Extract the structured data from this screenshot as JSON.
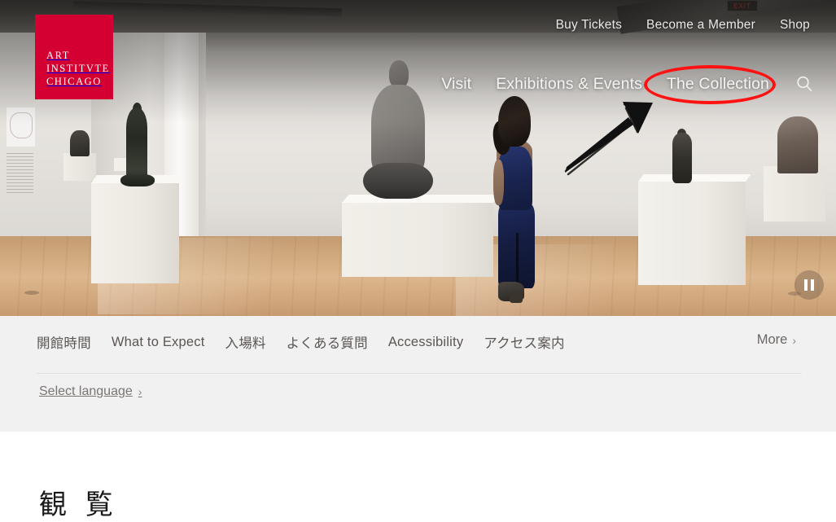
{
  "site": {
    "logo": {
      "lines": [
        "ART",
        "INSTITVTE",
        "CHICAGO"
      ],
      "color": "#d50032"
    }
  },
  "utility_nav": {
    "items": [
      {
        "label": "Buy Tickets"
      },
      {
        "label": "Become a Member"
      },
      {
        "label": "Shop"
      }
    ]
  },
  "main_nav": {
    "items": [
      {
        "label": "Visit"
      },
      {
        "label": "Exhibitions & Events"
      },
      {
        "label": "The Collection",
        "highlighted": true
      }
    ],
    "search_icon": "search-icon"
  },
  "hero": {
    "exit_sign": "EXIT",
    "media_control": {
      "icon": "pause-icon",
      "state": "playing"
    }
  },
  "annotations": {
    "ellipse": {
      "target": "The Collection",
      "color": "#ff1111"
    },
    "arrow": {
      "target": "The Collection",
      "color": "#111111",
      "direction": "up-right"
    }
  },
  "subnav": {
    "items": [
      {
        "label": "開館時間"
      },
      {
        "label": "What to Expect"
      },
      {
        "label": "入場料"
      },
      {
        "label": "よくある質問"
      },
      {
        "label": "Accessibility"
      },
      {
        "label": "アクセス案内"
      }
    ],
    "more_label": "More",
    "more_chevron": "›",
    "language_label": "Select language",
    "language_chevron": "›"
  },
  "page": {
    "title": "観 覧"
  }
}
